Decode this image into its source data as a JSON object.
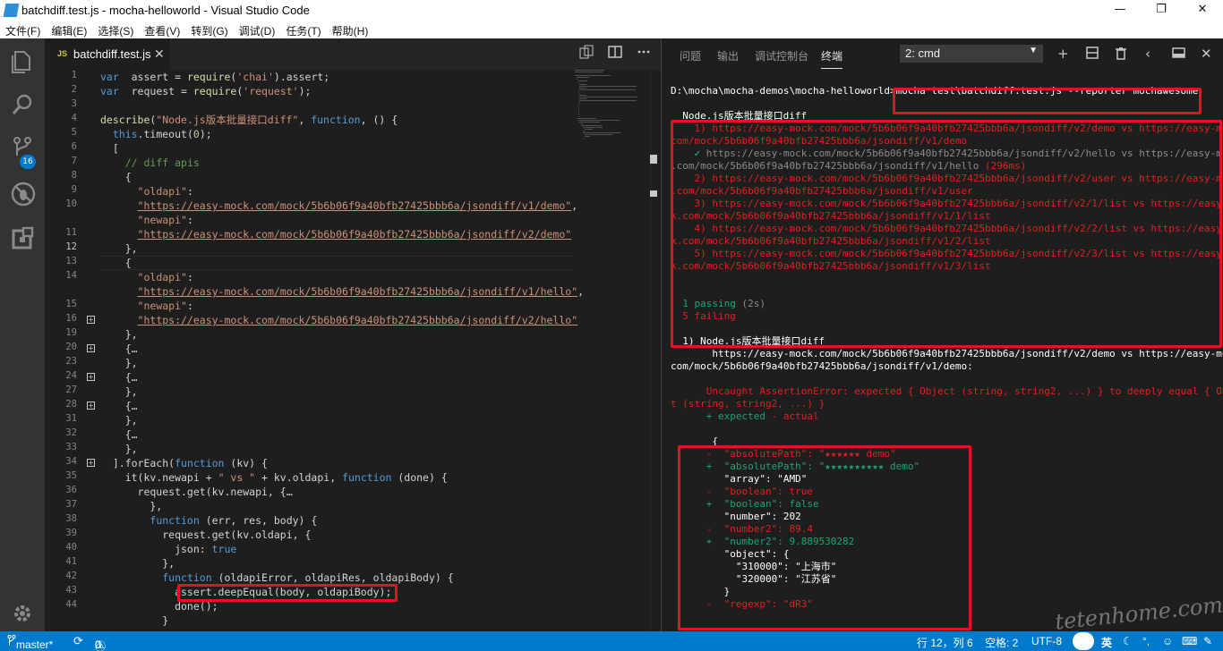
{
  "window": {
    "title": "batchdiff.test.js - mocha-helloworld - Visual Studio Code",
    "min": "—",
    "max": "❐",
    "close": "✕"
  },
  "menu": [
    "文件(F)",
    "编辑(E)",
    "选择(S)",
    "查看(V)",
    "转到(G)",
    "调试(D)",
    "任务(T)",
    "帮助(H)"
  ],
  "activity": {
    "scm_badge": "16"
  },
  "tab": {
    "icon": "JS",
    "label": "batchdiff.test.js",
    "close": "✕"
  },
  "editor": {
    "line_numbers": [
      {
        "n": "1",
        "cur": false
      },
      {
        "n": "2",
        "cur": false
      },
      {
        "n": "3",
        "cur": false
      },
      {
        "n": "4",
        "cur": false
      },
      {
        "n": "5",
        "cur": false
      },
      {
        "n": "6",
        "cur": false
      },
      {
        "n": "7",
        "cur": false
      },
      {
        "n": "8",
        "cur": false
      },
      {
        "n": "9",
        "cur": false
      },
      {
        "n": "10",
        "cur": false
      },
      {
        "n": "",
        "cur": false
      },
      {
        "n": "11",
        "cur": false
      },
      {
        "n": "12",
        "cur": true
      },
      {
        "n": "13",
        "cur": false
      },
      {
        "n": "14",
        "cur": false
      },
      {
        "n": "",
        "cur": false
      },
      {
        "n": "15",
        "cur": false
      },
      {
        "n": "16",
        "cur": false,
        "fold": true
      },
      {
        "n": "19",
        "cur": false
      },
      {
        "n": "20",
        "cur": false,
        "fold": true
      },
      {
        "n": "23",
        "cur": false
      },
      {
        "n": "24",
        "cur": false,
        "fold": true
      },
      {
        "n": "27",
        "cur": false
      },
      {
        "n": "28",
        "cur": false,
        "fold": true
      },
      {
        "n": "31",
        "cur": false
      },
      {
        "n": "32",
        "cur": false
      },
      {
        "n": "33",
        "cur": false
      },
      {
        "n": "34",
        "cur": false,
        "fold": true
      },
      {
        "n": "35",
        "cur": false
      },
      {
        "n": "36",
        "cur": false
      },
      {
        "n": "37",
        "cur": false
      },
      {
        "n": "38",
        "cur": false
      },
      {
        "n": "39",
        "cur": false
      },
      {
        "n": "40",
        "cur": false
      },
      {
        "n": "41",
        "cur": false
      },
      {
        "n": "42",
        "cur": false
      },
      {
        "n": "43",
        "cur": false
      },
      {
        "n": "44",
        "cur": false
      }
    ],
    "lines": [
      [
        [
          "kw",
          "var"
        ],
        [
          "",
          "  assert = "
        ],
        [
          "fn",
          "require"
        ],
        [
          "",
          "("
        ],
        [
          "str",
          "'chai'"
        ],
        [
          "",
          ").assert;"
        ]
      ],
      [
        [
          "kw",
          "var"
        ],
        [
          "",
          "  request = "
        ],
        [
          "fn",
          "require"
        ],
        [
          "",
          "("
        ],
        [
          "str",
          "'request'"
        ],
        [
          "",
          ");"
        ]
      ],
      [],
      [
        [
          "fn",
          "describe"
        ],
        [
          "",
          "("
        ],
        [
          "str",
          "\"Node.js版本批量接口diff\""
        ],
        [
          "",
          ", "
        ],
        [
          "kw",
          "function"
        ],
        [
          "",
          ", () {"
        ]
      ],
      [
        [
          "",
          "  "
        ],
        [
          "kw",
          "this"
        ],
        [
          "",
          ".timeout("
        ],
        [
          "num",
          "0"
        ],
        [
          "",
          ");"
        ]
      ],
      [
        [
          "",
          "  ["
        ]
      ],
      [
        [
          "",
          "    "
        ],
        [
          "cm",
          "// diff apis"
        ]
      ],
      [
        [
          "",
          "    {"
        ]
      ],
      [
        [
          "",
          "      "
        ],
        [
          "str",
          "\"oldapi\""
        ],
        [
          "",
          ":"
        ]
      ],
      [
        [
          "",
          "      "
        ],
        [
          "url",
          "\"https://easy-mock.com/mock/5b6b06f9a40bfb27425bbb6a/jsondiff/v1/demo\""
        ],
        [
          "",
          ","
        ]
      ],
      [
        [
          "",
          "      "
        ],
        [
          "str",
          "\"newapi\""
        ],
        [
          "",
          ":"
        ]
      ],
      [
        [
          "",
          "      "
        ],
        [
          "url",
          "\"https://easy-mock.com/mock/5b6b06f9a40bfb27425bbb6a/jsondiff/v2/demo\""
        ]
      ],
      [
        [
          "",
          "    },"
        ]
      ],
      [
        [
          "",
          "    {"
        ]
      ],
      [
        [
          "",
          "      "
        ],
        [
          "str",
          "\"oldapi\""
        ],
        [
          "",
          ":"
        ]
      ],
      [
        [
          "",
          "      "
        ],
        [
          "url",
          "\"https://easy-mock.com/mock/5b6b06f9a40bfb27425bbb6a/jsondiff/v1/hello\""
        ],
        [
          "",
          ","
        ]
      ],
      [
        [
          "",
          "      "
        ],
        [
          "str",
          "\"newapi\""
        ],
        [
          "",
          ":"
        ]
      ],
      [
        [
          "",
          "      "
        ],
        [
          "url",
          "\"https://easy-mock.com/mock/5b6b06f9a40bfb27425bbb6a/jsondiff/v2/hello\""
        ]
      ],
      [
        [
          "",
          "    },"
        ]
      ],
      [
        [
          "",
          "    {…"
        ]
      ],
      [
        [
          "",
          "    },"
        ]
      ],
      [
        [
          "",
          "    {…"
        ]
      ],
      [
        [
          "",
          "    },"
        ]
      ],
      [
        [
          "",
          "    {…"
        ]
      ],
      [
        [
          "",
          "    },"
        ]
      ],
      [
        [
          "",
          "    {…"
        ]
      ],
      [
        [
          "",
          "    },"
        ]
      ],
      [
        [
          "",
          "  ].forEach("
        ],
        [
          "kw",
          "function"
        ],
        [
          "",
          " (kv) {"
        ]
      ],
      [
        [
          "",
          "    it(kv.newapi + "
        ],
        [
          "str",
          "\" vs \""
        ],
        [
          "",
          " + kv.oldapi, "
        ],
        [
          "kw",
          "function"
        ],
        [
          "",
          " (done) {"
        ]
      ],
      [
        [
          "",
          "      request.get(kv.newapi, {…"
        ]
      ],
      [
        [
          "",
          "        },"
        ]
      ],
      [
        [
          "",
          "        "
        ],
        [
          "kw",
          "function"
        ],
        [
          "",
          " (err, res, body) {"
        ]
      ],
      [
        [
          "",
          "          request.get(kv.oldapi, {"
        ]
      ],
      [
        [
          "",
          "            json: "
        ],
        [
          "kw",
          "true"
        ]
      ],
      [
        [
          "",
          "          },"
        ]
      ],
      [
        [
          "",
          "          "
        ],
        [
          "kw",
          "function"
        ],
        [
          "",
          " (oldapiError, oldapiRes, oldapiBody) {"
        ]
      ],
      [
        [
          "",
          "            assert.deepEqual(body, oldapiBody);"
        ]
      ],
      [
        [
          "",
          "            done();"
        ]
      ],
      [
        [
          "",
          "          }"
        ]
      ]
    ]
  },
  "panel": {
    "tabs": [
      "问题",
      "输出",
      "调试控制台",
      "终端"
    ],
    "active_tab": "终端",
    "terminal_select": "2: cmd",
    "icons": [
      "+",
      "⧉",
      "🗑",
      "‹",
      "▭",
      "✕"
    ]
  },
  "terminal": [
    [
      [
        "white",
        "D:\\mocha\\mocha-demos\\mocha-helloworld>mocha test\\batchdiff.test.js --reporter mochawesome"
      ]
    ],
    [],
    [
      [
        "white",
        "  Node.js版本批量接口diff"
      ]
    ],
    [
      [
        "red",
        "    1) https://easy-mock.com/mock/5b6b06f9a40bfb27425bbb6a/jsondiff/v2/demo vs https://easy-m"
      ]
    ],
    [
      [
        "red",
        "com/mock/5b6b06f9a40bfb27425bbb6a/jsondiff/v1/demo"
      ]
    ],
    [
      [
        "gc",
        "    ✓ "
      ],
      [
        "grey",
        "https://easy-mock.com/mock/5b6b06f9a40bfb27425bbb6a/jsondiff/v2/hello vs https://easy-m"
      ]
    ],
    [
      [
        "grey",
        ".com/mock/5b6b06f9a40bfb27425bbb6a/jsondiff/v1/hello "
      ],
      [
        "red",
        "(296ms)"
      ]
    ],
    [
      [
        "red",
        "    2) https://easy-mock.com/mock/5b6b06f9a40bfb27425bbb6a/jsondiff/v2/user vs https://easy-m"
      ]
    ],
    [
      [
        "red",
        ".com/mock/5b6b06f9a40bfb27425bbb6a/jsondiff/v1/user"
      ]
    ],
    [
      [
        "red",
        "    3) https://easy-mock.com/mock/5b6b06f9a40bfb27425bbb6a/jsondiff/v2/1/list vs https://easy"
      ]
    ],
    [
      [
        "red",
        "k.com/mock/5b6b06f9a40bfb27425bbb6a/jsondiff/v1/1/list"
      ]
    ],
    [
      [
        "red",
        "    4) https://easy-mock.com/mock/5b6b06f9a40bfb27425bbb6a/jsondiff/v2/2/list vs https://easy"
      ]
    ],
    [
      [
        "red",
        "k.com/mock/5b6b06f9a40bfb27425bbb6a/jsondiff/v1/2/list"
      ]
    ],
    [
      [
        "red",
        "    5) https://easy-mock.com/mock/5b6b06f9a40bfb27425bbb6a/jsondiff/v2/3/list vs https://easy"
      ]
    ],
    [
      [
        "red",
        "k.com/mock/5b6b06f9a40bfb27425bbb6a/jsondiff/v1/3/list"
      ]
    ],
    [],
    [],
    [
      [
        "green",
        "  1 passing "
      ],
      [
        "grey",
        "(2s)"
      ]
    ],
    [
      [
        "red",
        "  5 failing"
      ]
    ],
    [],
    [
      [
        "white",
        "  1) Node.js版本批量接口diff"
      ]
    ],
    [
      [
        "white",
        "       https://easy-mock.com/mock/5b6b06f9a40bfb27425bbb6a/jsondiff/v2/demo vs https://easy-mo"
      ]
    ],
    [
      [
        "white",
        "com/mock/5b6b06f9a40bfb27425bbb6a/jsondiff/v1/demo:"
      ]
    ],
    [],
    [
      [
        "red",
        "      Uncaught AssertionError: expected { Object (string, string2, ...) } to deeply equal { Ob"
      ]
    ],
    [
      [
        "red",
        "t (string, string2, ...) }"
      ]
    ],
    [
      [
        "green",
        "      + expected "
      ],
      [
        "red",
        "- actual"
      ]
    ],
    [],
    [
      [
        "white",
        "       {"
      ]
    ],
    [
      [
        "red",
        "      -  \"absolutePath\": \"★★★★★★ demo\""
      ]
    ],
    [
      [
        "green",
        "      +  \"absolutePath\": \"★★★★★★★★★★ demo\""
      ]
    ],
    [
      [
        "white",
        "         \"array\": \"AMD\""
      ]
    ],
    [
      [
        "red",
        "      -  \"boolean\": true"
      ]
    ],
    [
      [
        "green",
        "      +  \"boolean\": false"
      ]
    ],
    [
      [
        "white",
        "         \"number\": 202"
      ]
    ],
    [
      [
        "red",
        "      -  \"number2\": 89.4"
      ]
    ],
    [
      [
        "green",
        "      +  \"number2\": 9.889530282"
      ]
    ],
    [
      [
        "white",
        "         \"object\": {"
      ]
    ],
    [
      [
        "white",
        "           \"310000\": \"上海市\""
      ]
    ],
    [
      [
        "white",
        "           \"320000\": \"江苏省\""
      ]
    ],
    [
      [
        "white",
        "         }"
      ]
    ],
    [
      [
        "red",
        "      -  \"regexp\": \"dR3\""
      ]
    ]
  ],
  "status": {
    "branch": "master*",
    "sync": "⟳",
    "errors": "0",
    "warnings": "0",
    "position": "行 12，列 6",
    "spaces": "空格: 2",
    "encoding": "UTF-8",
    "ime": "英"
  },
  "watermark": "tetenhome.com"
}
